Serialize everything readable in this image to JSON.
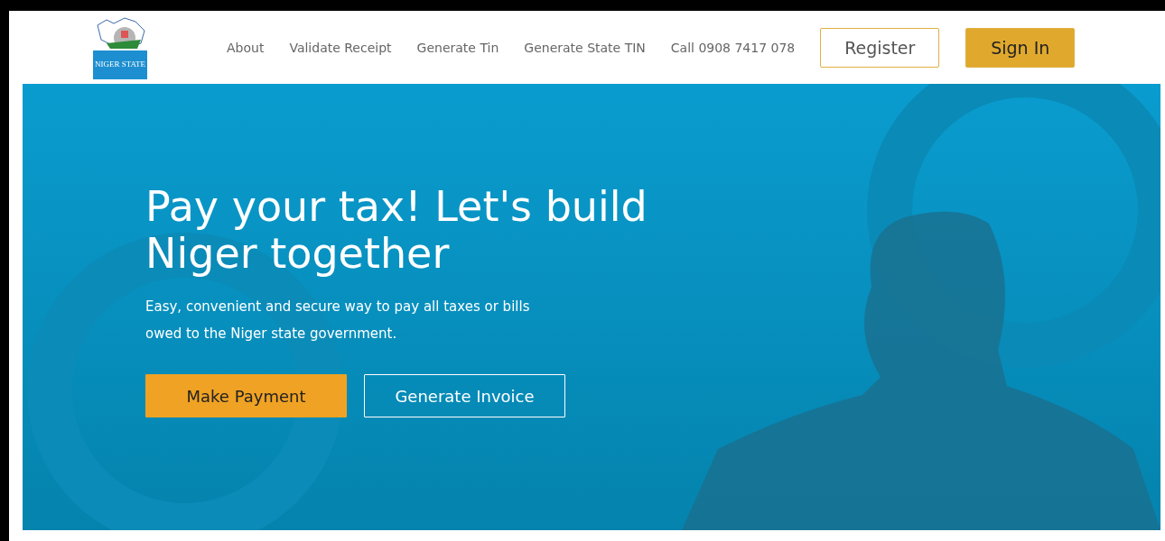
{
  "logo": {
    "text": "NIGER STATE"
  },
  "nav": {
    "links": [
      "About",
      "Validate Receipt",
      "Generate Tin",
      "Generate State TIN",
      "Call 0908 7417 078"
    ],
    "buttons": [
      {
        "label": "Register",
        "kind": "outline"
      },
      {
        "label": "Sign In",
        "kind": "filled"
      }
    ]
  },
  "hero": {
    "title": "Pay your tax! Let's build Niger together",
    "subtitle": "Easy, convenient and secure way to pay all taxes or bills owed to the Niger state government.",
    "buttons": [
      {
        "label": "Make Payment",
        "kind": "filled"
      },
      {
        "label": "Generate Invoice",
        "kind": "outline"
      }
    ]
  }
}
